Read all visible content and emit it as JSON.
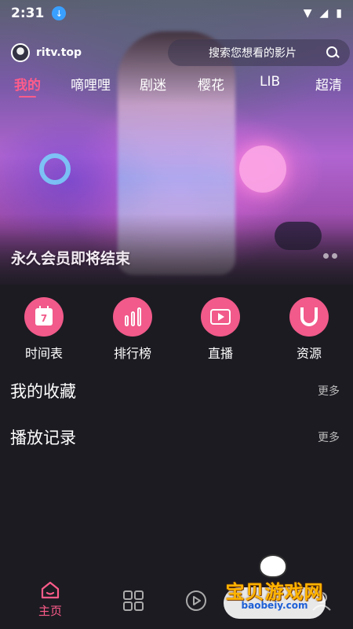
{
  "status_bar": {
    "time": "2:31"
  },
  "header": {
    "site_name": "ritv.top",
    "search_placeholder": "搜索您想看的影片"
  },
  "tabs": [
    {
      "label": "我的",
      "active": true
    },
    {
      "label": "嘀哩哩",
      "active": false
    },
    {
      "label": "剧迷",
      "active": false
    },
    {
      "label": "樱花",
      "active": false
    },
    {
      "label": "LIB",
      "active": false
    },
    {
      "label": "超清",
      "active": false
    }
  ],
  "banner": {
    "title": "永久会员即将结束"
  },
  "quick_actions": [
    {
      "label": "时间表",
      "icon": "calendar-icon",
      "calendar_day": "7"
    },
    {
      "label": "排行榜",
      "icon": "bar-chart-icon"
    },
    {
      "label": "直播",
      "icon": "tv-play-icon"
    },
    {
      "label": "资源",
      "icon": "magnet-icon"
    }
  ],
  "sections": [
    {
      "title": "我的收藏",
      "more": "更多"
    },
    {
      "title": "播放记录",
      "more": "更多"
    }
  ],
  "bottom_nav": [
    {
      "label": "主页",
      "icon": "home-icon",
      "active": true
    },
    {
      "label": "",
      "icon": "grid-icon",
      "active": false
    },
    {
      "label": "",
      "icon": "play-icon",
      "active": false
    },
    {
      "label": "",
      "icon": "user-icon",
      "active": false
    }
  ],
  "watermark": {
    "text": "宝贝游戏网",
    "url": "baobeiy.com"
  },
  "colors": {
    "accent": "#ff5c8a",
    "action_circle": "#f15a8a",
    "background": "#1c1b22"
  }
}
